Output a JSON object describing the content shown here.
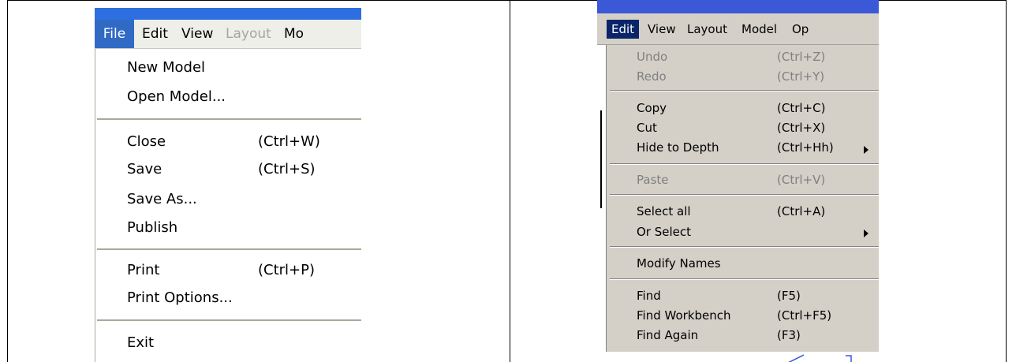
{
  "file_menu_screenshot": {
    "menubar": [
      {
        "label": "File",
        "state": "active"
      },
      {
        "label": "Edit",
        "state": "normal"
      },
      {
        "label": "View",
        "state": "normal"
      },
      {
        "label": "Layout",
        "state": "disabled"
      },
      {
        "label": "Mo",
        "state": "normal"
      }
    ],
    "items": [
      {
        "label": "New Model",
        "shortcut": ""
      },
      {
        "label": "Open Model...",
        "shortcut": ""
      },
      {
        "label": "Close",
        "shortcut": "(Ctrl+W)"
      },
      {
        "label": "Save",
        "shortcut": "(Ctrl+S)"
      },
      {
        "label": "Save As...",
        "shortcut": ""
      },
      {
        "label": "Publish",
        "shortcut": ""
      },
      {
        "label": "Print",
        "shortcut": "(Ctrl+P)"
      },
      {
        "label": "Print Options...",
        "shortcut": ""
      },
      {
        "label": "Exit",
        "shortcut": ""
      }
    ]
  },
  "edit_menu_screenshot": {
    "menubar": [
      {
        "label": "Edit",
        "state": "active"
      },
      {
        "label": "View",
        "state": "normal"
      },
      {
        "label": "Layout",
        "state": "normal"
      },
      {
        "label": "Model",
        "state": "normal"
      },
      {
        "label": "Op",
        "state": "normal"
      }
    ],
    "items": [
      {
        "label": "Undo",
        "shortcut": "(Ctrl+Z)",
        "enabled": false
      },
      {
        "label": "Redo",
        "shortcut": "(Ctrl+Y)",
        "enabled": false
      },
      {
        "label": "Copy",
        "shortcut": "(Ctrl+C)",
        "enabled": true
      },
      {
        "label": "Cut",
        "shortcut": "(Ctrl+X)",
        "enabled": true
      },
      {
        "label": "Hide to Depth",
        "shortcut": "(Ctrl+Hh)",
        "enabled": true,
        "submenu": true
      },
      {
        "label": "Paste",
        "shortcut": "(Ctrl+V)",
        "enabled": false
      },
      {
        "label": "Select all",
        "shortcut": "(Ctrl+A)",
        "enabled": true
      },
      {
        "label": "Or Select",
        "shortcut": "",
        "enabled": true,
        "submenu": true
      },
      {
        "label": "Modify Names",
        "shortcut": "",
        "enabled": true
      },
      {
        "label": "Find",
        "shortcut": "(F5)",
        "enabled": true
      },
      {
        "label": "Find Workbench",
        "shortcut": "(Ctrl+F5)",
        "enabled": true
      },
      {
        "label": "Find Again",
        "shortcut": "(F3)",
        "enabled": true
      }
    ]
  },
  "colors": {
    "active_menu_xp": "#316ac5",
    "active_menu_classic": "#0a246a",
    "disabled_text": "#808080"
  },
  "icons": [
    "submenu-arrow-icon"
  ]
}
